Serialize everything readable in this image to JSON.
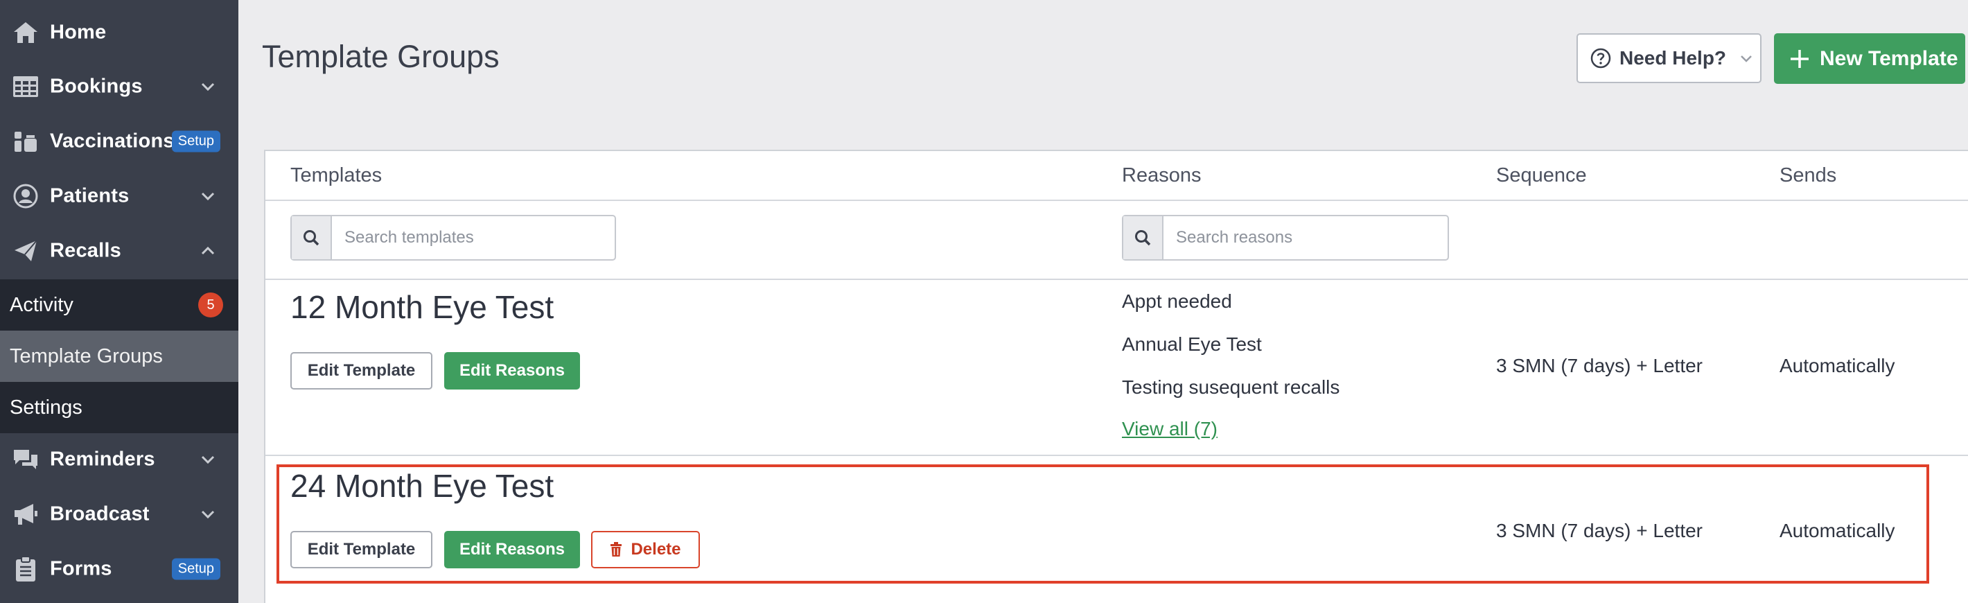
{
  "sidebar": {
    "items": [
      {
        "label": "Home"
      },
      {
        "label": "Bookings"
      },
      {
        "label": "Vaccinations",
        "badge": "Setup"
      },
      {
        "label": "Patients"
      },
      {
        "label": "Recalls"
      },
      {
        "label": "Reminders"
      },
      {
        "label": "Broadcast"
      },
      {
        "label": "Forms",
        "badge": "Setup"
      }
    ],
    "recalls_sub": [
      {
        "label": "Activity",
        "count": "5"
      },
      {
        "label": "Template Groups",
        "active": true
      },
      {
        "label": "Settings"
      }
    ]
  },
  "header": {
    "title": "Template Groups",
    "help_label": "Need Help?",
    "new_label": "New Template"
  },
  "table": {
    "columns": [
      "Templates",
      "Reasons",
      "Sequence",
      "Sends"
    ],
    "search_templates_placeholder": "Search templates",
    "search_reasons_placeholder": "Search reasons",
    "rows": [
      {
        "name": "12 Month Eye Test",
        "edit_template": "Edit Template",
        "edit_reasons": "Edit Reasons",
        "reasons": [
          "Appt needed",
          "Annual Eye Test",
          "Testing susequent recalls"
        ],
        "view_all": "View all (7)",
        "sequence": "3 SMN (7 days) + Letter",
        "sends": "Automatically"
      },
      {
        "name": "24 Month Eye Test",
        "edit_template": "Edit Template",
        "edit_reasons": "Edit Reasons",
        "delete": "Delete",
        "sequence": "3 SMN (7 days) + Letter",
        "sends": "Automatically"
      }
    ]
  },
  "colors": {
    "sidebar_bg": "#3a3f4b",
    "accent_green": "#3f9e5f",
    "setup_badge": "#2c6fc0",
    "danger": "#d9452b"
  },
  "icons": [
    "home-icon",
    "calendar-grid-icon",
    "vials-icon",
    "user-circle-icon",
    "paper-plane-icon",
    "comments-icon",
    "megaphone-icon",
    "clipboard-icon",
    "question-circle-icon",
    "plus-icon",
    "search-icon",
    "trash-icon"
  ]
}
